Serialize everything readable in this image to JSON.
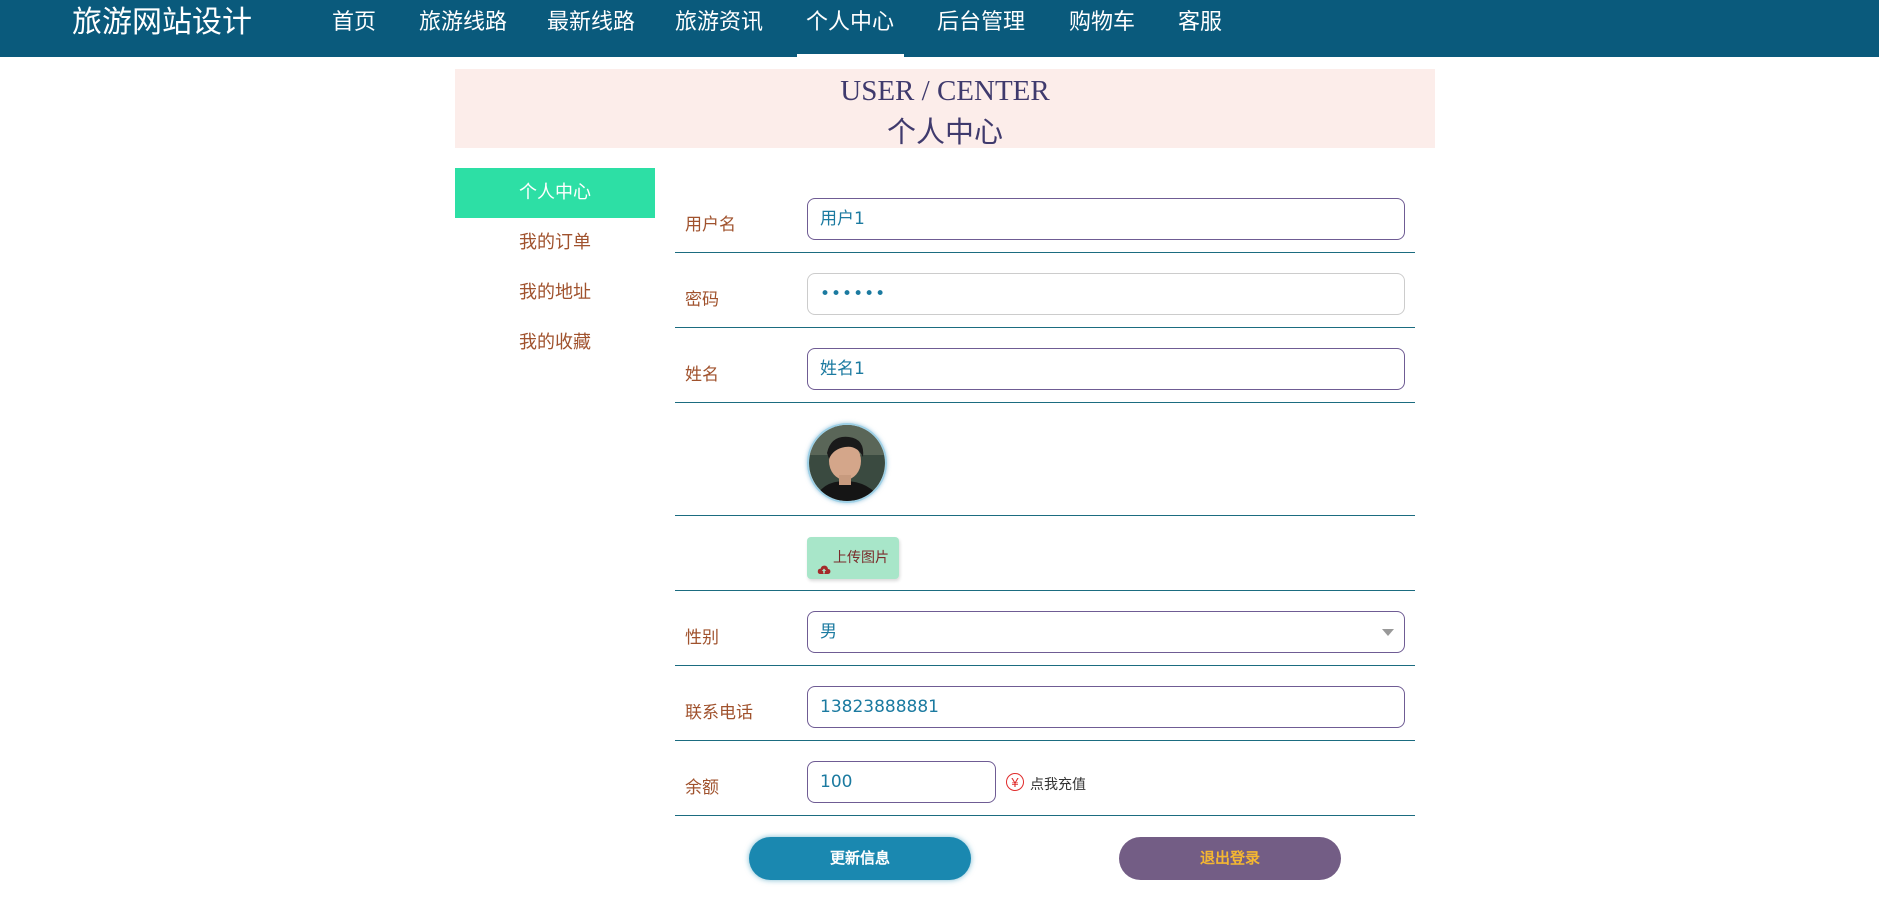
{
  "nav": {
    "brand": "旅游网站设计",
    "items": [
      "首页",
      "旅游线路",
      "最新线路",
      "旅游资讯",
      "个人中心",
      "后台管理",
      "购物车",
      "客服"
    ],
    "active_index": 4
  },
  "banner": {
    "en": "USER / CENTER",
    "cn": "个人中心"
  },
  "sidebar": {
    "items": [
      "个人中心",
      "我的订单",
      "我的地址",
      "我的收藏"
    ],
    "active_index": 0
  },
  "form": {
    "username_label": "用户名",
    "username_value": "用户1",
    "password_label": "密码",
    "password_value": "••••••",
    "name_label": "姓名",
    "name_value": "姓名1",
    "upload_label": "上传图片",
    "gender_label": "性别",
    "gender_value": "男",
    "phone_label": "联系电话",
    "phone_value": "13823888881",
    "balance_label": "余额",
    "balance_value": "100",
    "yen_symbol": "¥",
    "recharge_label": "点我充值"
  },
  "actions": {
    "update_label": "更新信息",
    "logout_label": "退出登录"
  },
  "colors": {
    "nav_bg": "#0a5a7c",
    "banner_bg": "#fcedea",
    "sidebar_active": "#2ddfa5",
    "label": "#a0522d",
    "update_btn": "#1a88b0",
    "logout_btn": "#735d85",
    "logout_text": "#f5b731"
  }
}
